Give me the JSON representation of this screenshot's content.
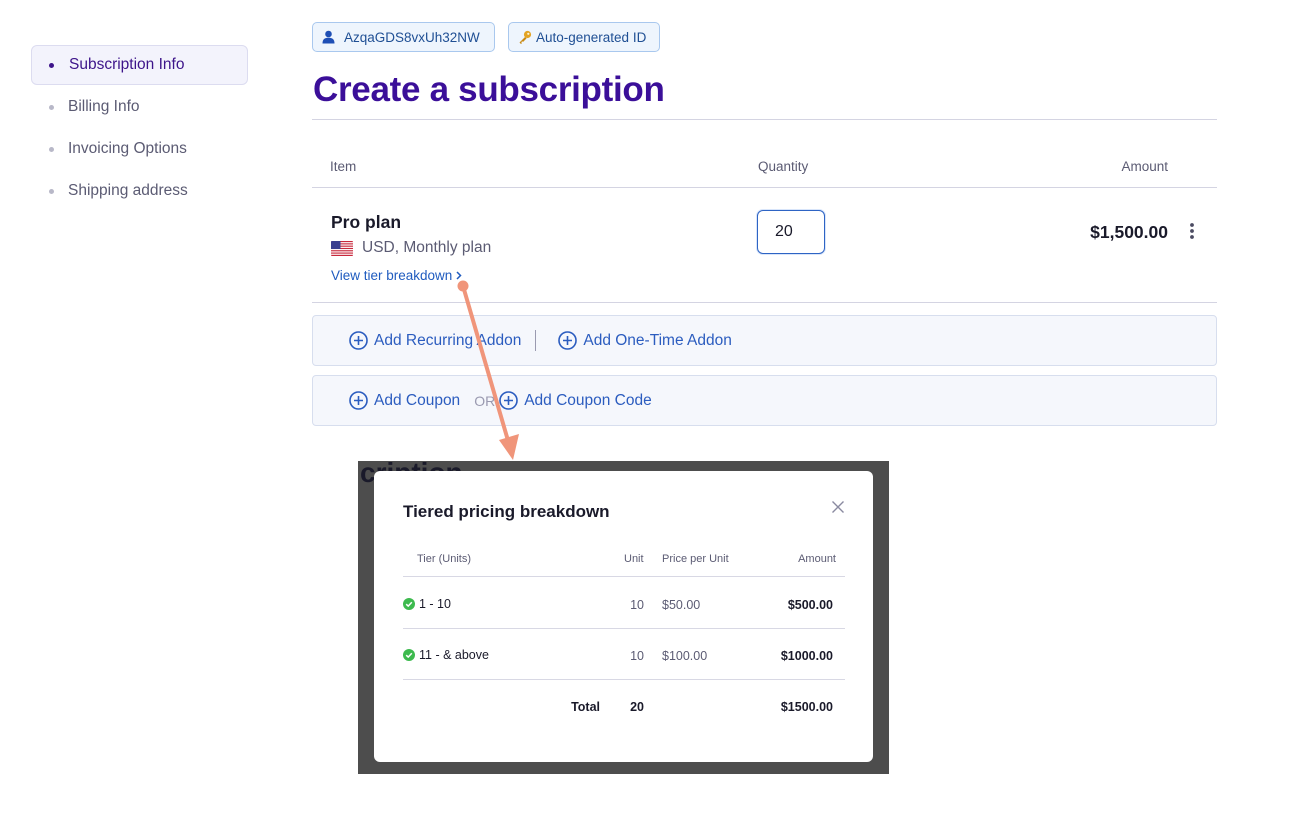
{
  "sidebar": {
    "items": [
      {
        "label": "Subscription Info",
        "active": true
      },
      {
        "label": "Billing Info"
      },
      {
        "label": "Invoicing Options"
      },
      {
        "label": "Shipping address"
      }
    ]
  },
  "header": {
    "customer_id": "AzqaGDS8vxUh32NW",
    "auto_id_label": "Auto-generated ID",
    "title": "Create a subscription"
  },
  "table": {
    "headers": {
      "item": "Item",
      "quantity": "Quantity",
      "amount": "Amount"
    },
    "row": {
      "plan_name": "Pro plan",
      "plan_meta": "USD, Monthly plan",
      "tier_link": "View tier breakdown",
      "quantity": "20",
      "amount": "$1,500.00"
    }
  },
  "addons": {
    "recurring": "Add Recurring Addon",
    "one_time": "Add One-Time Addon",
    "coupon": "Add Coupon",
    "or": "OR",
    "coupon_code": "Add Coupon Code"
  },
  "modal": {
    "background_fragment": "cription",
    "title": "Tiered pricing breakdown",
    "headers": {
      "tier": "Tier (Units)",
      "unit": "Unit",
      "price": "Price per Unit",
      "amount": "Amount"
    },
    "rows": [
      {
        "tier": "1 - 10",
        "unit": "10",
        "price": "$50.00",
        "amount": "$500.00"
      },
      {
        "tier": "11 - & above",
        "unit": "10",
        "price": "$100.00",
        "amount": "$1000.00"
      }
    ],
    "total": {
      "label": "Total",
      "unit": "20",
      "amount": "$1500.00"
    }
  },
  "colors": {
    "brand": "#3b0f99",
    "link": "#1f5bbf",
    "annotation_arrow": "#f0957a",
    "success": "#3dba4e"
  }
}
